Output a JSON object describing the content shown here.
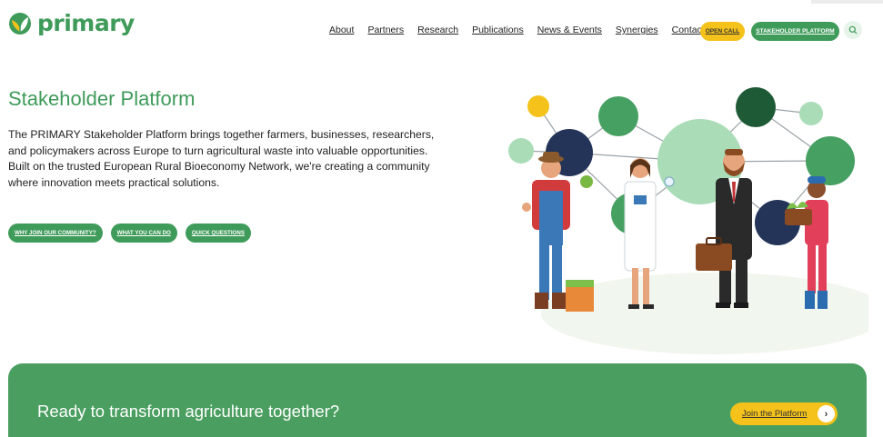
{
  "brand": {
    "name": "primary",
    "green": "#3f9b5a",
    "yellow": "#f4c21a"
  },
  "nav": {
    "items": [
      "About",
      "Partners",
      "Research",
      "Publications",
      "News & Events",
      "Synergies",
      "Contact"
    ],
    "open_call": "OPEN CALL",
    "stakeholder_platform": "STAKEHOLDER PLATFORM",
    "search_icon": "search-icon"
  },
  "hero": {
    "title": "Stakeholder Platform",
    "description": "The PRIMARY Stakeholder Platform brings together farmers, businesses, researchers, and policymakers across Europe to turn agricultural waste into valuable opportunities. Built on the trusted European Rural Bioeconomy Network, we're creating a community where innovation meets practical solutions.",
    "buttons": [
      "WHY JOIN OUR COMMUNITY?",
      "WHAT YOU CAN DO",
      "QUICK QUESTIONS"
    ]
  },
  "cta": {
    "title": "Ready to transform agriculture together?",
    "button": "Join the Platform",
    "arrow_icon": "chevron-right-icon"
  }
}
